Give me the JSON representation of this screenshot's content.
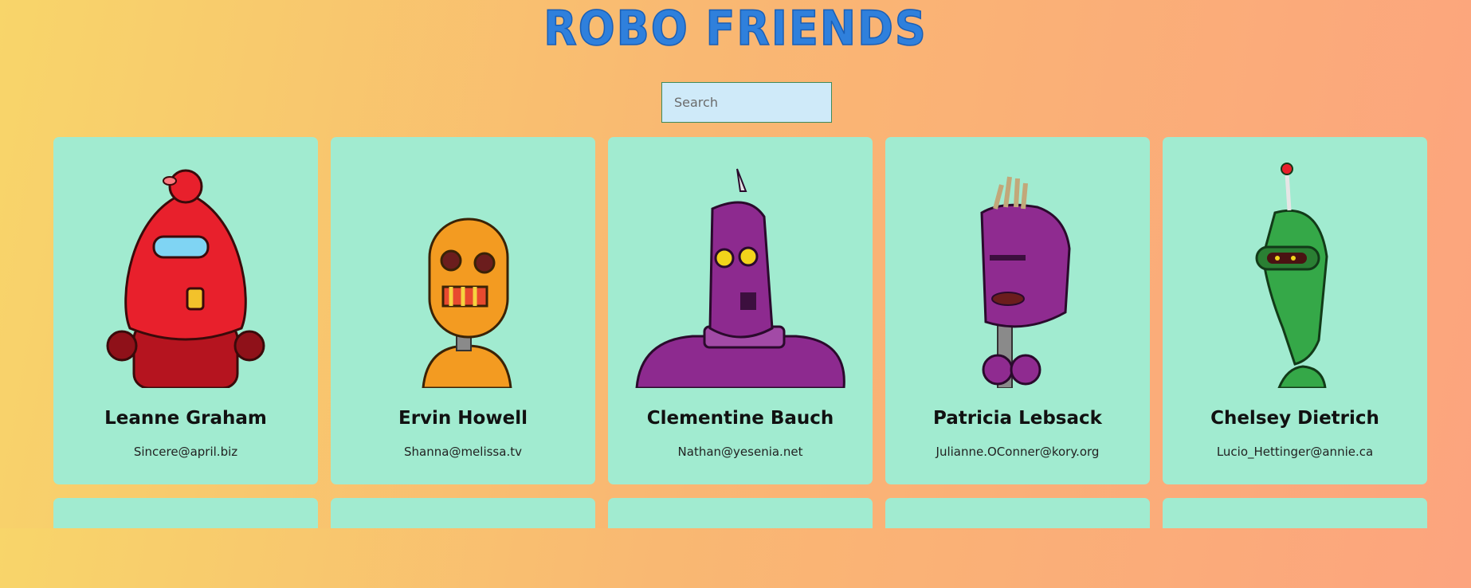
{
  "app": {
    "title": "ROBO FRIENDS"
  },
  "search": {
    "placeholder": "Search",
    "value": ""
  },
  "robots": [
    {
      "name": "Leanne Graham",
      "email": "Sincere@april.biz",
      "color": "#e8202c"
    },
    {
      "name": "Ervin Howell",
      "email": "Shanna@melissa.tv",
      "color": "#f39b21"
    },
    {
      "name": "Clementine Bauch",
      "email": "Nathan@yesenia.net",
      "color": "#8d2a8f"
    },
    {
      "name": "Patricia Lebsack",
      "email": "Julianne.OConner@kory.org",
      "color": "#8f2b90"
    },
    {
      "name": "Chelsey Dietrich",
      "email": "Lucio_Hettinger@annie.ca",
      "color": "#35a848"
    }
  ],
  "colors": {
    "card": "#a1ebd0",
    "title": "#2f80dc",
    "search_bg": "#cfeaf9"
  }
}
